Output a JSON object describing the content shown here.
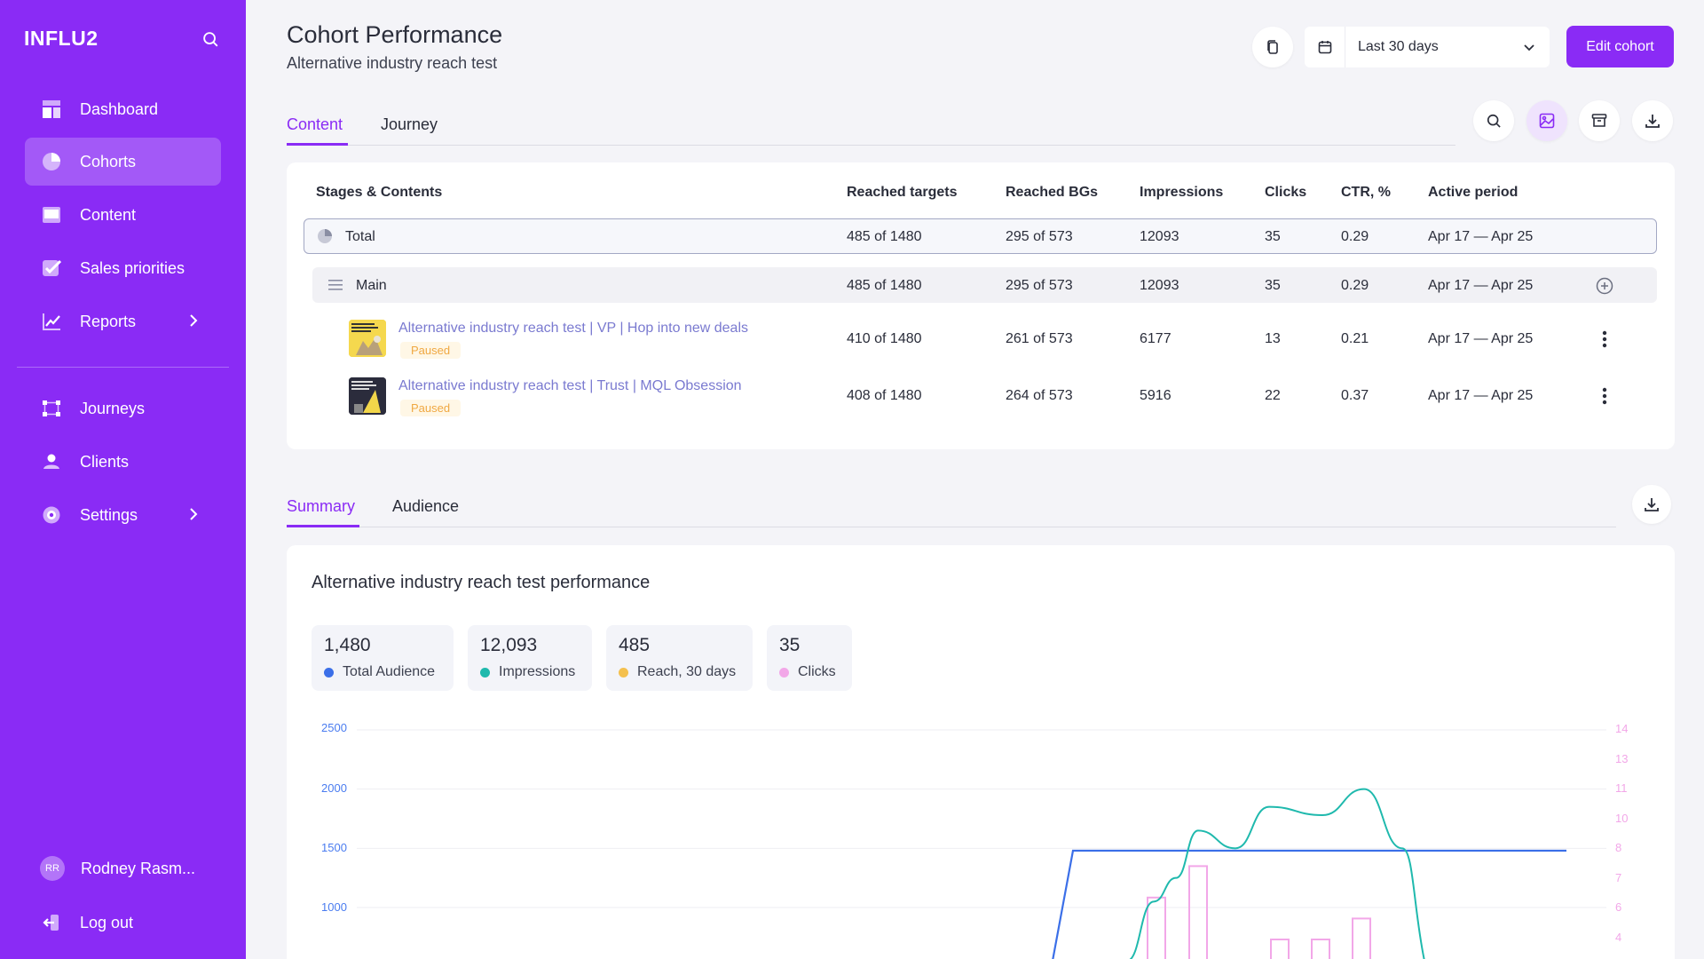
{
  "app": {
    "brand": "INFLU2"
  },
  "colors": {
    "accent": "#8a2bf5",
    "paused": "#f0a842",
    "link": "#7a7ad0",
    "audience": "#3b6fe8",
    "impressions": "#1fb9ad",
    "reach": "#f4c04e",
    "clicks": "#f2a7e8"
  },
  "sidebar": {
    "items": [
      {
        "label": "Dashboard",
        "icon": "dashboard-icon"
      },
      {
        "label": "Cohorts",
        "icon": "pie-chart-icon",
        "active": true
      },
      {
        "label": "Content",
        "icon": "monitor-icon"
      },
      {
        "label": "Sales priorities",
        "icon": "check-icon"
      },
      {
        "label": "Reports",
        "icon": "line-chart-icon",
        "has_submenu": true
      },
      {
        "label": "Journeys",
        "icon": "journey-icon"
      },
      {
        "label": "Clients",
        "icon": "user-icon"
      },
      {
        "label": "Settings",
        "icon": "gear-icon",
        "has_submenu": true
      }
    ],
    "user": {
      "initials": "RR",
      "name": "Rodney Rasm..."
    },
    "logout_label": "Log out"
  },
  "header": {
    "title": "Cohort Performance",
    "subtitle": "Alternative industry reach test",
    "date_range": "Last 30 days",
    "edit_label": "Edit cohort"
  },
  "tabs": [
    {
      "label": "Content",
      "active": true
    },
    {
      "label": "Journey"
    }
  ],
  "table": {
    "columns": [
      "Stages & Contents",
      "Reached targets",
      "Reached BGs",
      "Impressions",
      "Clicks",
      "CTR, %",
      "Active period"
    ],
    "total": {
      "label": "Total",
      "reached_targets": "485 of 1480",
      "reached_bgs": "295 of 573",
      "impressions": "12093",
      "clicks": "35",
      "ctr": "0.29",
      "period": "Apr 17 — Apr 25"
    },
    "stage": {
      "label": "Main",
      "reached_targets": "485 of 1480",
      "reached_bgs": "295 of 573",
      "impressions": "12093",
      "clicks": "35",
      "ctr": "0.29",
      "period": "Apr 17 — Apr 25"
    },
    "contents": [
      {
        "title": "Alternative industry reach test | VP | Hop into new deals",
        "status": "Paused",
        "reached_targets": "410 of 1480",
        "reached_bgs": "261 of 573",
        "impressions": "6177",
        "clicks": "13",
        "ctr": "0.21",
        "period": "Apr 17 — Apr 25"
      },
      {
        "title": "Alternative industry reach test | Trust | MQL Obsession",
        "status": "Paused",
        "reached_targets": "408 of 1480",
        "reached_bgs": "264 of 573",
        "impressions": "5916",
        "clicks": "22",
        "ctr": "0.37",
        "period": "Apr 17 — Apr 25"
      }
    ]
  },
  "summary_tabs": [
    {
      "label": "Summary",
      "active": true
    },
    {
      "label": "Audience"
    }
  ],
  "summary": {
    "title": "Alternative industry reach test performance",
    "stats": [
      {
        "value": "1,480",
        "label": "Total Audience"
      },
      {
        "value": "12,093",
        "label": "Impressions"
      },
      {
        "value": "485",
        "label": "Reach, 30 days"
      },
      {
        "value": "35",
        "label": "Clicks"
      }
    ]
  },
  "chart_data": {
    "type": "line",
    "y_left_ticks": [
      "2500",
      "2000",
      "1500",
      "1000"
    ],
    "y_right_ticks": [
      "14",
      "13",
      "11",
      "10",
      "8",
      "7",
      "6",
      "4"
    ],
    "ylim_left": [
      1000,
      2500
    ],
    "ylim_right": [
      4,
      14
    ],
    "series": [
      {
        "name": "Total Audience",
        "type": "line",
        "values": [
          1000,
          1480,
          1480,
          1480,
          1480,
          1480,
          1480,
          1480,
          1480,
          1480,
          1480,
          1480,
          1480
        ]
      },
      {
        "name": "Impressions",
        "type": "line",
        "values": [
          1000,
          1050,
          1250,
          1650,
          1500,
          1850,
          1780,
          2000,
          1500,
          1000
        ]
      },
      {
        "name": "Clicks",
        "type": "bar",
        "values": [
          6,
          7.5,
          4,
          4,
          5
        ]
      }
    ]
  }
}
